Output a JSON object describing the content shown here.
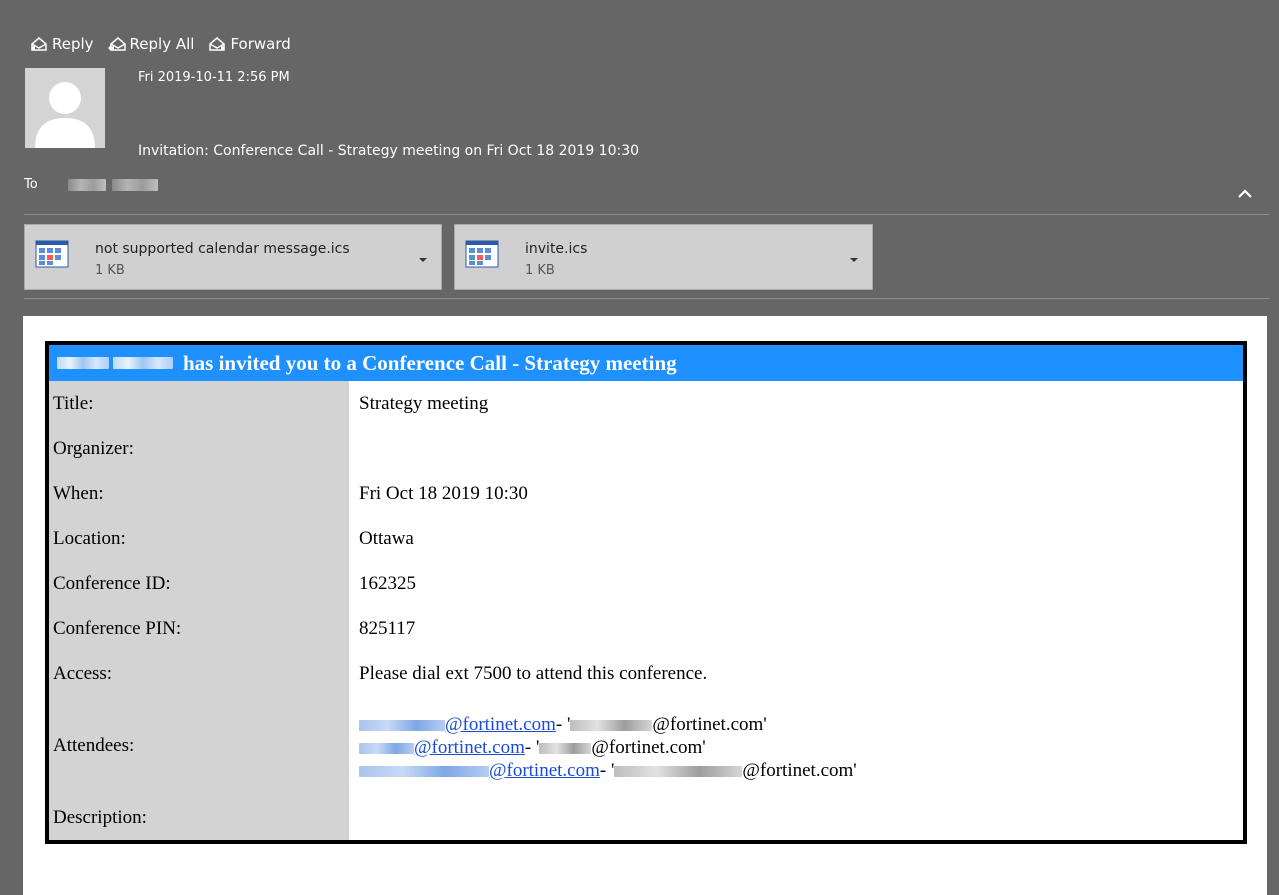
{
  "toolbar": {
    "reply_label": "Reply",
    "reply_all_label": "Reply All",
    "forward_label": "Forward"
  },
  "message": {
    "sent": "Fri 2019-10-11 2:56 PM",
    "subject": "Invitation: Conference Call -  Strategy meeting on Fri Oct 18 2019 10:30",
    "to_label": "To"
  },
  "attachments": [
    {
      "name": "not supported calendar message.ics",
      "size": "1 KB",
      "icon": "calendar-file-icon"
    },
    {
      "name": "invite.ics",
      "size": "1 KB",
      "icon": "calendar-file-icon"
    }
  ],
  "invite": {
    "header_text": "has invited you to a Conference Call - Strategy meeting",
    "rows": [
      {
        "label": "Title:",
        "value": "Strategy meeting"
      },
      {
        "label": "Organizer:",
        "value": ""
      },
      {
        "label": "When:",
        "value": "Fri Oct 18 2019 10:30"
      },
      {
        "label": "Location:",
        "value": "Ottawa"
      },
      {
        "label": "Conference ID:",
        "value": "162325"
      },
      {
        "label": "Conference PIN:",
        "value": "825117"
      },
      {
        "label": "Access:",
        "value": "Please dial ext 7500 to attend this conference."
      }
    ],
    "attendees_label": "Attendees:",
    "attendees": [
      {
        "link_text": "@fortinet.com",
        "separator": " - '",
        "address_text": "@fortinet.com'"
      },
      {
        "link_text": "@fortinet.com",
        "separator": " - '",
        "address_text": "@fortinet.com'"
      },
      {
        "link_text": "@fortinet.com",
        "separator": " - '",
        "address_text": "@fortinet.com'"
      }
    ],
    "description_label": "Description:",
    "colors": {
      "header_bg": "#1e90ff",
      "label_bg": "#d3d3d3",
      "link": "#1a4bd6"
    }
  }
}
